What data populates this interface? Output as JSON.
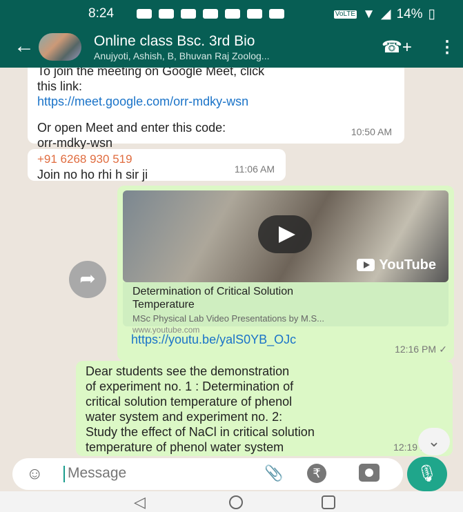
{
  "status_bar": {
    "time": "8:24",
    "volte": "VoLTE",
    "battery": "14%",
    "notif_icons": [
      "notif-alert-icon",
      "notif-youtube-icon",
      "notif-youtube-icon",
      "notif-youtube-icon",
      "notif-youtube-icon",
      "notif-youtube-icon",
      "notif-youtube-icon"
    ]
  },
  "header": {
    "title": "Online class Bsc. 3rd Bio",
    "subtitle": "Anujyoti, Ashish, B, Bhuvan Raj Zoolog...",
    "icons": [
      "back-arrow-icon",
      "group-avatar",
      "add-call-icon",
      "more-vert-icon"
    ]
  },
  "messages": [
    {
      "type": "incoming",
      "lines": [
        "To join the meeting on Google Meet, click",
        "this link:"
      ],
      "link": "https://meet.google.com/orr-mdky-wsn",
      "extra_lines": [
        "Or open Meet and enter this code:",
        "orr-mdky-wsn"
      ],
      "time": "10:50 AM"
    },
    {
      "type": "incoming",
      "sender": "+91 6268 930 519",
      "text": "Join no ho rhi h sir ji",
      "time": "11:06 AM"
    },
    {
      "type": "outgoing",
      "preview": {
        "badge": "YouTube",
        "title_lines": [
          "Determination of Critical Solution",
          "Temperature"
        ],
        "description": "MSc Physical Lab Video Presentations by M.S...",
        "site": "www.youtube.com"
      },
      "link": "https://youtu.be/yalS0YB_OJc",
      "time": "12:16 PM",
      "status": "sent"
    },
    {
      "type": "outgoing",
      "lines": [
        "Dear students see the demonstration",
        "of experiment no. 1 : Determination of",
        "critical solution temperature of phenol",
        "water system and experiment no. 2:",
        "Study the effect of NaCl in critical solution",
        "temperature of phenol water system"
      ],
      "time": "12:19 PM",
      "status": "sent"
    }
  ],
  "input": {
    "placeholder": "Message",
    "icons": [
      "emoji-icon",
      "attach-icon",
      "payment-icon",
      "camera-icon",
      "mic-icon"
    ]
  },
  "nav": {
    "icons": [
      "nav-back-icon",
      "nav-home-icon",
      "nav-recents-icon"
    ]
  }
}
